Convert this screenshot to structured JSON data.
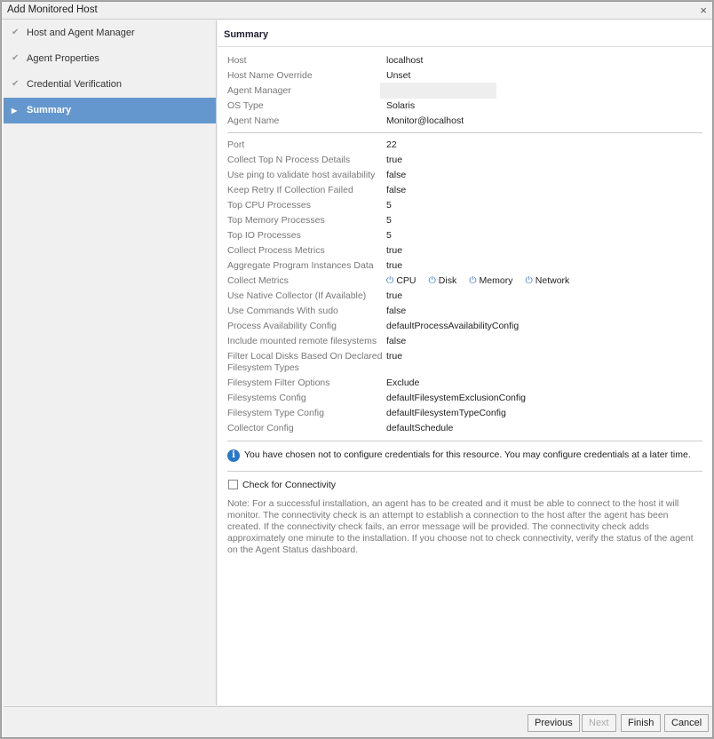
{
  "window": {
    "title": "Add Monitored Host",
    "close": "×"
  },
  "steps": [
    {
      "label": "Host and Agent Manager"
    },
    {
      "label": "Agent Properties"
    },
    {
      "label": "Credential Verification"
    },
    {
      "label": "Summary"
    }
  ],
  "summary": {
    "title": "Summary",
    "group1": [
      {
        "k": "Host",
        "v": "localhost"
      },
      {
        "k": "Host Name Override",
        "v": "Unset"
      },
      {
        "k": "Agent Manager",
        "v": ""
      },
      {
        "k": "OS Type",
        "v": "Solaris"
      },
      {
        "k": "Agent Name",
        "v": "Monitor@localhost"
      }
    ],
    "group2": [
      {
        "k": "Port",
        "v": "22"
      },
      {
        "k": "Collect Top N Process Details",
        "v": "true"
      },
      {
        "k": "Use ping to validate host availability",
        "v": "false"
      },
      {
        "k": "Keep Retry If Collection Failed",
        "v": "false"
      },
      {
        "k": "Top CPU Processes",
        "v": "5"
      },
      {
        "k": "Top Memory Processes",
        "v": "5"
      },
      {
        "k": "Top IO Processes",
        "v": "5"
      },
      {
        "k": "Collect Process Metrics",
        "v": "true"
      },
      {
        "k": "Aggregate Program Instances Data",
        "v": "true"
      },
      {
        "k": "Collect Metrics",
        "v": ""
      },
      {
        "k": "Use Native Collector (If Available)",
        "v": "true"
      },
      {
        "k": "Use Commands With sudo",
        "v": "false"
      },
      {
        "k": "Process Availability Config",
        "v": "defaultProcessAvailabilityConfig"
      },
      {
        "k": "Include mounted remote filesystems",
        "v": "false"
      },
      {
        "k": "Filter Local Disks Based On Declared Filesystem Types",
        "v": "true"
      },
      {
        "k": "Filesystem Filter Options",
        "v": "Exclude"
      },
      {
        "k": "Filesystems Config",
        "v": "defaultFilesystemExclusionConfig"
      },
      {
        "k": "Filesystem Type Config",
        "v": "defaultFilesystemTypeConfig"
      },
      {
        "k": "Collector Config",
        "v": "defaultSchedule"
      }
    ],
    "metrics": [
      "CPU",
      "Disk",
      "Memory",
      "Network"
    ],
    "info": "You have chosen not to configure credentials for this resource. You may configure credentials at a later time.",
    "check_label": "Check for Connectivity",
    "note": "Note: For a successful installation, an agent has to be created and it must be able to connect to the host it will monitor. The connectivity check is an attempt to establish a connection to the host after the agent has been created. If the connectivity check fails, an error message will be provided. The connectivity check adds approximately one minute to the installation. If you choose not to check connectivity, verify the status of the agent on the Agent Status dashboard."
  },
  "buttons": {
    "previous": "Previous",
    "next": "Next",
    "finish": "Finish",
    "cancel": "Cancel"
  }
}
